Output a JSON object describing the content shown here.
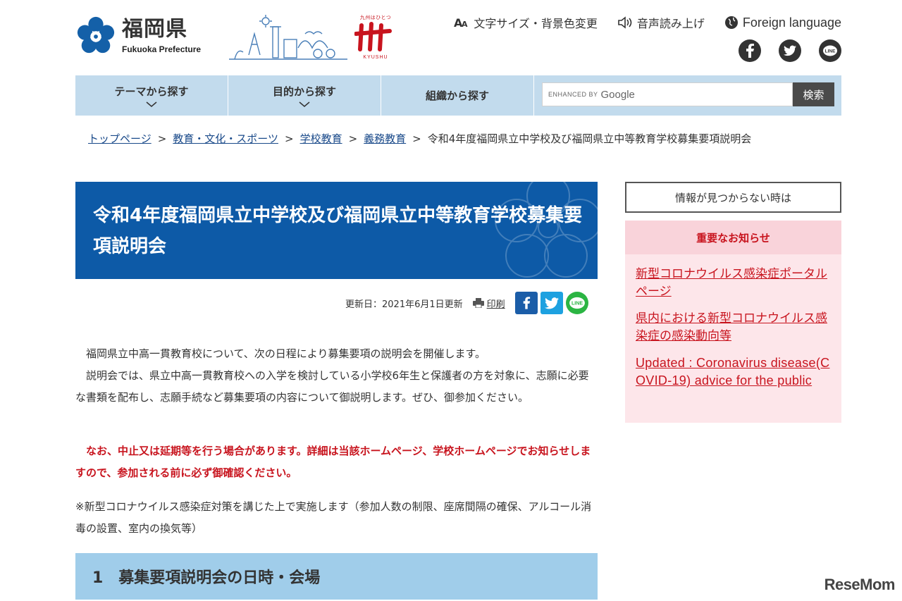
{
  "header": {
    "logo_jp": "福岡県",
    "logo_en": "Fukuoka Prefecture",
    "kyushu_logo_small": "九州はひとつ",
    "kyushu_logo_sub": "KYUSHU",
    "util": {
      "font_size": "文字サイズ・背景色変更",
      "read_aloud": "音声読み上げ",
      "foreign": "Foreign language"
    },
    "social": [
      "facebook-icon",
      "twitter-icon",
      "line-icon"
    ]
  },
  "nav": {
    "items": [
      {
        "label": "テーマから探す"
      },
      {
        "label": "目的から探す"
      },
      {
        "label": "組織から探す"
      }
    ],
    "search_enhanced": "ENHANCED BY",
    "search_google": "Google",
    "search_button": "検索"
  },
  "breadcrumb": {
    "items": [
      "トップページ",
      "教育・文化・スポーツ",
      "学校教育",
      "義務教育"
    ],
    "current": "令和4年度福岡県立中学校及び福岡県立中等教育学校募集要項説明会",
    "separator": ">"
  },
  "main": {
    "title": "令和4年度福岡県立中学校及び福岡県立中等教育学校募集要項説明会",
    "updated": "更新日：2021年6月1日更新",
    "print": "印刷",
    "paragraph1": "福岡県立中高一貫教育校について、次の日程により募集要項の説明会を開催します。",
    "paragraph2": "説明会では、県立中高一貫教育校への入学を検討している小学校6年生と保護者の方を対象に、志願に必要な書類を配布し、志願手続など募集要項の内容について御説明します。ぜひ、御参加ください。",
    "notice": "なお、中止又は延期等を行う場合があります。詳細は当該ホームページ、学校ホームページでお知らせしますので、参加される前に必ず御確認ください。",
    "covid_note": "※新型コロナウイルス感染症対策を講じた上で実施します（参加人数の制限、座席間隔の確保、アルコール消毒の設置、室内の換気等）",
    "section1": "1　募集要項説明会の日時・会場"
  },
  "sidebar": {
    "not_found": "情報が見つからない時は",
    "important_title": "重要なお知らせ",
    "links": [
      "新型コロナウイルス感染症ポータルページ",
      "県内における新型コロナウイルス感染症の感染動向等",
      "Updated : Coronavirus disease(COVID-19) advice for the public"
    ]
  },
  "watermark": "ReseMom",
  "colors": {
    "title_bg": "#0d5aa7",
    "nav_bg": "#c2dbed",
    "section_bg": "#a0cdea",
    "notice_red": "#c8141e",
    "important_bg": "#fde6ea"
  }
}
